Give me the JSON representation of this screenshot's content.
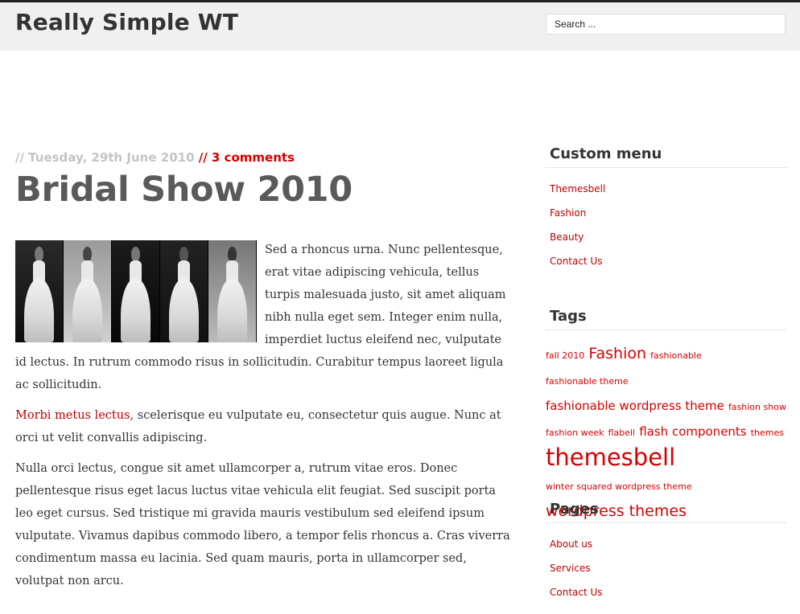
{
  "site": {
    "title": "Really Simple WT"
  },
  "search": {
    "placeholder": "Search ..."
  },
  "post": {
    "date": "// Tuesday, 29th June 2010",
    "comments": "// 3 comments",
    "title": "Bridal Show 2010",
    "para1": "Sed a rhoncus urna. Nunc pellentesque, erat vitae adipiscing vehicula, tellus turpis malesuada justo, sit amet aliquam nibh nulla eget sem. Integer enim nulla, imperdiet luctus eleifend nec, vulputate id lectus. In rutrum commodo risus in sollicitudin. Curabitur tempus laoreet ligula ac sollicitudin.",
    "para2_link": "Morbi metus lectus",
    "para2_rest": ", scelerisque eu vulputate eu, consectetur quis augue. Nunc at orci ut velit convallis adipiscing.",
    "para3": "Nulla orci lectus, congue sit amet ullamcorper a, rutrum vitae eros. Donec pellentesque risus eget lacus luctus vitae vehicula elit feugiat. Sed suscipit porta leo eget cursus. Sed tristique mi gravida mauris vestibulum sed eleifend ipsum vulputate. Vivamus dapibus commodo libero, a tempor felis rhoncus a. Cras viverra condimentum massa eu lacinia. Sed quam mauris, porta in ullamcorper sed, volutpat non arcu."
  },
  "sidebar": {
    "custom_menu": {
      "title": "Custom menu",
      "items": [
        "Themesbell",
        "Fashion",
        "Beauty",
        "Contact Us"
      ]
    },
    "tags": {
      "title": "Tags",
      "items": [
        {
          "label": "fall 2010",
          "weight": 1
        },
        {
          "label": "Fashion",
          "weight": 3
        },
        {
          "label": "fashionable",
          "weight": 1
        },
        {
          "label": "fashionable theme",
          "weight": 1
        },
        {
          "label": "fashionable wordpress theme",
          "weight": 2
        },
        {
          "label": "fashion show",
          "weight": 1
        },
        {
          "label": "fashion week",
          "weight": 1
        },
        {
          "label": "flabell",
          "weight": 1
        },
        {
          "label": "flash components",
          "weight": 2
        },
        {
          "label": "themes",
          "weight": 1
        },
        {
          "label": "themesbell",
          "weight": 5
        },
        {
          "label": "winter squared wordpress theme",
          "weight": 1
        },
        {
          "label": "wordpress themes",
          "weight": 3
        }
      ]
    },
    "pages": {
      "title": "Pages",
      "items": [
        "About us",
        "Services",
        "Contact Us"
      ]
    }
  },
  "colors": {
    "accent": "#d40000",
    "link": "#c00000",
    "header_bg": "#f0f0f0"
  }
}
